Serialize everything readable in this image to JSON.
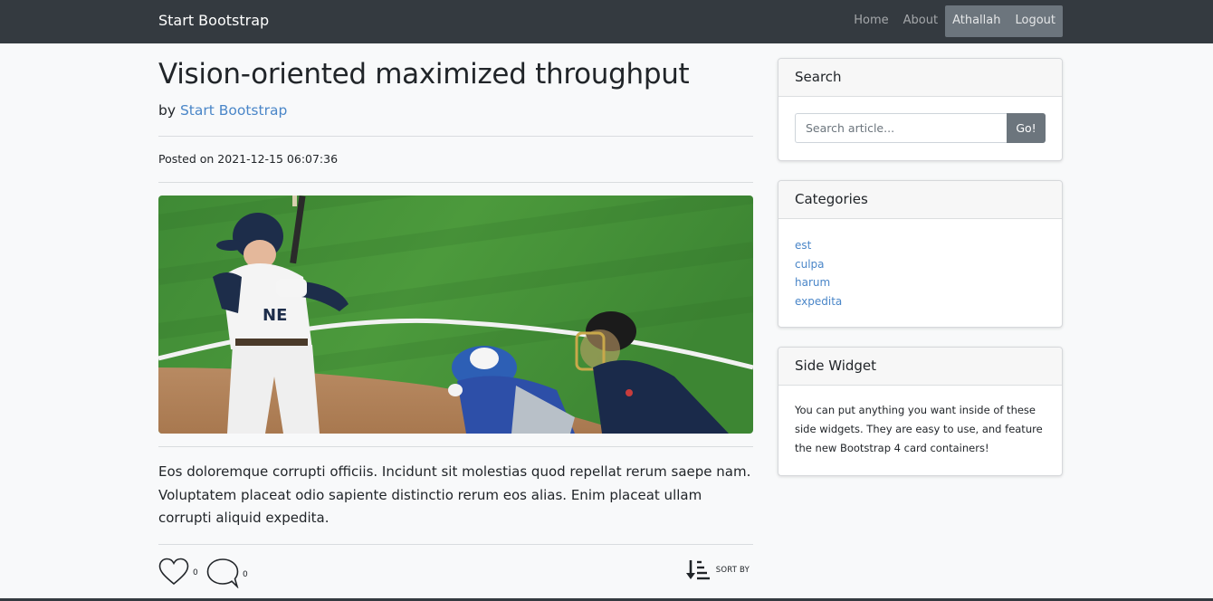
{
  "navbar": {
    "brand": "Start Bootstrap",
    "links": {
      "home": "Home",
      "about": "About",
      "user": "Athallah",
      "logout": "Logout"
    }
  },
  "post": {
    "title": "Vision-oriented maximized throughput",
    "byline_prefix": "by",
    "author": "Start Bootstrap",
    "posted_on": "Posted on 2021-12-15 06:07:36",
    "image_icon": "baseball-photo",
    "body": "Eos doloremque corrupti officiis. Incidunt sit molestias quod repellat rerum saepe nam. Voluptatem placeat odio sapiente distinctio rerum eos alias. Enim placeat ullam corrupti aliquid expedita.",
    "likes": "0",
    "comments": "0",
    "sort_label": "SORT BY"
  },
  "sidebar": {
    "search": {
      "title": "Search",
      "placeholder": "Search article...",
      "button": "Go!"
    },
    "categories": {
      "title": "Categories",
      "items": [
        "est",
        "culpa",
        "harum",
        "expedita"
      ]
    },
    "widget": {
      "title": "Side Widget",
      "text": "You can put anything you want inside of these side widgets. They are easy to use, and feature the new Bootstrap 4 card containers!"
    }
  },
  "colors": {
    "navbar_bg": "#343a40",
    "link": "#4a86c8",
    "button_secondary": "#6c757d",
    "page_bg": "#f8f9fa"
  }
}
